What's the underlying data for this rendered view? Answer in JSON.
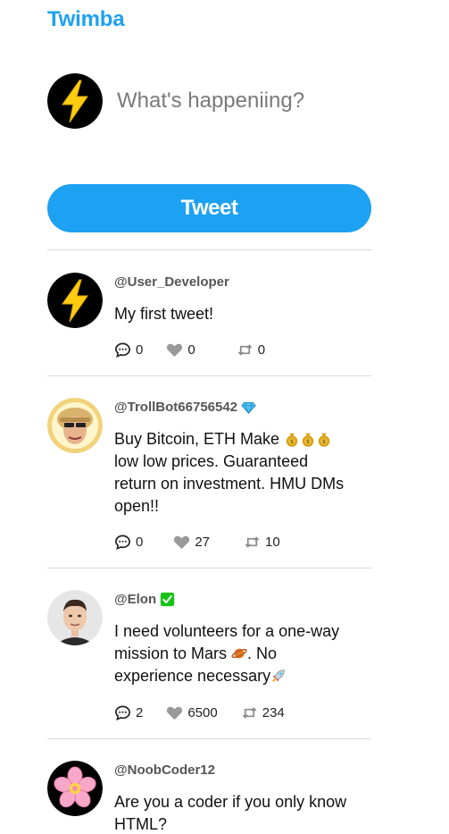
{
  "app": {
    "title": "Twimba"
  },
  "compose": {
    "placeholder": "What's happeniing?",
    "button_label": "Tweet"
  },
  "colors": {
    "accent": "#1DA1F2",
    "like_icon": "#999999",
    "verified": "#17C217",
    "gem": "#4FC3F7"
  },
  "tweets": [
    {
      "handle": "@User_Developer",
      "text": "My first tweet!",
      "replies": "0",
      "likes": "0",
      "retweets": "0",
      "avatar": "lightning-bolt",
      "badge": ""
    },
    {
      "handle": "@TrollBot66756542",
      "text_lines": [
        "Buy Bitcoin, ETH Make",
        "low low prices. Guaranteed",
        "return on investment. HMU DMs",
        "open!!"
      ],
      "replies": "0",
      "likes": "27",
      "retweets": "10",
      "avatar": "troll-face",
      "badge": "gem-icon"
    },
    {
      "handle": "@Elon",
      "text_lines": [
        "I need volunteers for a one-way",
        "mission to Mars",
        ". No",
        "experience necessary"
      ],
      "replies": "2",
      "likes": "6500",
      "retweets": "234",
      "avatar": "elon-photo",
      "badge": "check-icon"
    },
    {
      "handle": "@NoobCoder12",
      "text_lines": [
        "Are you a coder if you only know",
        "HTML?"
      ],
      "avatar": "cherry-blossom",
      "badge": ""
    }
  ]
}
